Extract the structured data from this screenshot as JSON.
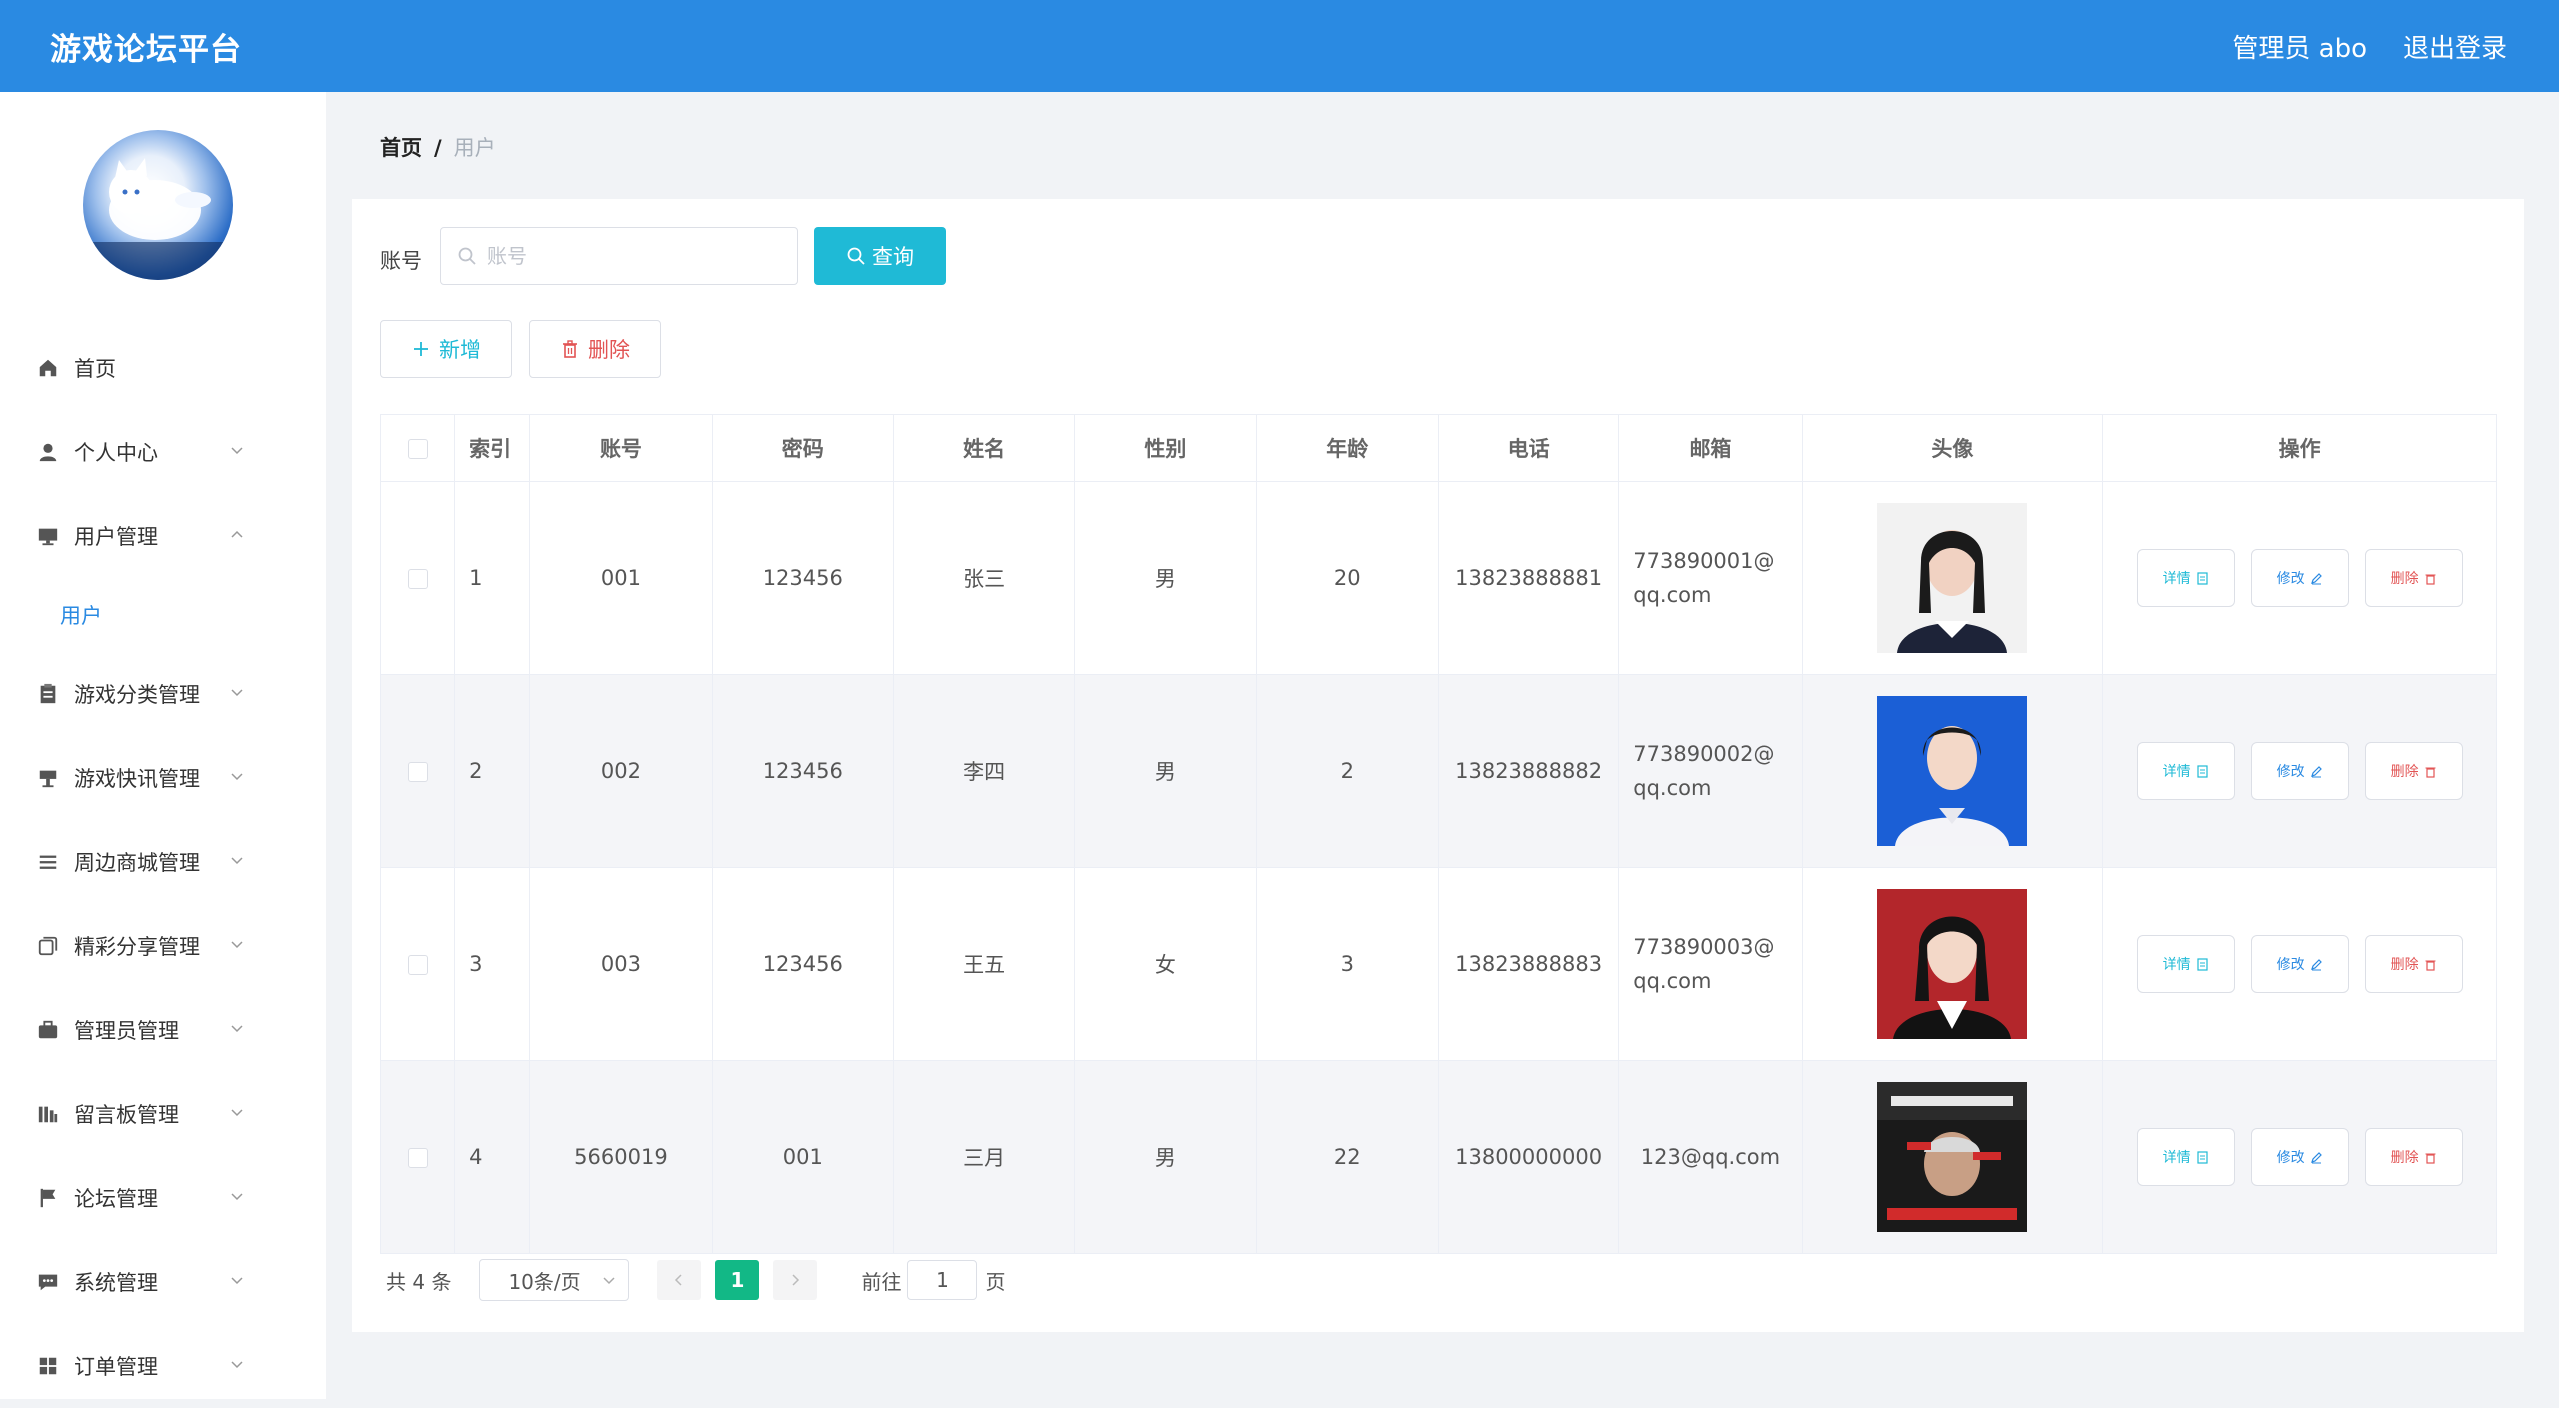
{
  "header": {
    "app_title": "游戏论坛平台",
    "admin_label": "管理员 abo",
    "logout_label": "退出登录"
  },
  "sidebar": {
    "items": [
      {
        "label": "首页",
        "icon": "home-icon"
      },
      {
        "label": "个人中心",
        "icon": "user-icon"
      },
      {
        "label": "用户管理",
        "icon": "monitor-icon",
        "expanded": true,
        "sub": "用户"
      },
      {
        "label": "游戏分类管理",
        "icon": "clipboard-icon"
      },
      {
        "label": "游戏快讯管理",
        "icon": "podium-icon"
      },
      {
        "label": "周边商城管理",
        "icon": "list-icon"
      },
      {
        "label": "精彩分享管理",
        "icon": "copy-icon"
      },
      {
        "label": "管理员管理",
        "icon": "briefcase-icon"
      },
      {
        "label": "留言板管理",
        "icon": "chart-icon"
      },
      {
        "label": "论坛管理",
        "icon": "flag-icon"
      },
      {
        "label": "系统管理",
        "icon": "message-icon"
      },
      {
        "label": "订单管理",
        "icon": "grid-icon"
      }
    ]
  },
  "breadcrumb": {
    "home": "首页",
    "separator": "/",
    "current": "用户"
  },
  "search": {
    "label": "账号",
    "placeholder": "账号",
    "value": "",
    "button": "查询"
  },
  "toolbar": {
    "add_label": "新增",
    "delete_label": "删除"
  },
  "table": {
    "columns": [
      "索引",
      "账号",
      "密码",
      "姓名",
      "性别",
      "年龄",
      "电话",
      "邮箱",
      "头像",
      "操作"
    ],
    "rows": [
      {
        "index": "1",
        "account": "001",
        "password": "123456",
        "name": "张三",
        "gender": "男",
        "age": "20",
        "phone": "13823888881",
        "email": "773890001@qq.com",
        "photo": "portrait-black-bg"
      },
      {
        "index": "2",
        "account": "002",
        "password": "123456",
        "name": "李四",
        "gender": "男",
        "age": "2",
        "phone": "13823888882",
        "email": "773890002@qq.com",
        "photo": "portrait-blue-bg"
      },
      {
        "index": "3",
        "account": "003",
        "password": "123456",
        "name": "王五",
        "gender": "女",
        "age": "3",
        "phone": "13823888883",
        "email": "773890003@qq.com",
        "photo": "portrait-red-bg"
      },
      {
        "index": "4",
        "account": "5660019",
        "password": "001",
        "name": "三月",
        "gender": "男",
        "age": "22",
        "phone": "13800000000",
        "email": "123@qq.com",
        "photo": "meme-poster"
      }
    ],
    "actions": {
      "detail": "详情",
      "edit": "修改",
      "delete": "删除"
    }
  },
  "pagination": {
    "total_text": "共 4 条",
    "page_size": "10条/页",
    "current_page": "1",
    "goto_label": "前往",
    "goto_value": "1",
    "page_suffix": "页"
  },
  "colors": {
    "header": "#2a8ae2",
    "accent": "#1fbad6",
    "danger": "#e25454",
    "active_page": "#12b886"
  }
}
